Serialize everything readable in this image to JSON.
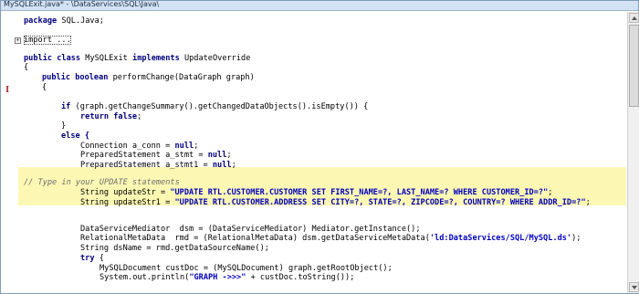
{
  "window": {
    "title": "MySQLExit.java* - \\DataServices\\SQL\\Java\\"
  },
  "colors": {
    "keyword": "#00007f",
    "string": "#0000c0",
    "comment": "#6f6f6f",
    "highlight": "#fcf8b4"
  },
  "gutter": {
    "cursor_marker": "I"
  },
  "code": {
    "l1_kw": "package",
    "l1_text": " SQL.Java;",
    "l2_text": "import ...",
    "l3_kw": "public class",
    "l3_name": " MySQLExit ",
    "l3_kw2": "implements",
    "l3_rest": " UpdateOverride",
    "l4_text": "{",
    "l5_kw": "public boolean",
    "l5_rest": " performChange(DataGraph graph)",
    "l6_text": "{",
    "l7_kw": "if",
    "l7_rest": " (graph.getChangeSummary().getChangedDataObjects().isEmpty()) {",
    "l8_kw": "return",
    "l8_kw2": " false",
    "l8_rest": ";",
    "l9_text": "}",
    "l10_text": "else {",
    "l11_text": "Connection a_conn = ",
    "l11_kw": "null",
    "l11_end": ";",
    "l12_text": "PreparedStatement a_stmt = ",
    "l12_kw": "null",
    "l12_end": ";",
    "l13_text": "PreparedStatement a_stmt1 = ",
    "l13_kw": "null",
    "l13_end": ";",
    "l14_comment": "// Type in your UPDATE statements",
    "l15_text": "String updateStr = ",
    "l15_str": "\"UPDATE RTL.CUSTOMER.CUSTOMER SET FIRST_NAME=?, LAST_NAME=? WHERE CUSTOMER_ID=?\"",
    "l15_end": ";",
    "l16_text": "String updateStr1 = ",
    "l16_str": "\"UPDATE RTL.CUSTOMER.ADDRESS SET CITY=?, STATE=?, ZIPCODE=?, COUNTRY=? WHERE ADDR_ID=?\"",
    "l16_end": ";",
    "l17_text": "DataServiceMediator  dsm = (DataServiceMediator) Mediator.getInstance();",
    "l18_text": "RelationalMetaData  rmd = (RelationalMetaData) dsm.getDataServiceMetaData(",
    "l18_str": "'ld:DataServices/SQL/MySQL.ds'",
    "l18_end": ");",
    "l19_text": "String dsName = rmd.getDataSourceName();",
    "l20_kw": "try",
    "l20_rest": " {",
    "l21_text": "MySQLDocument custDoc = (MySQLDocument) graph.getRootObject();",
    "l22_text": "System.out.println(",
    "l22_str": "\"GRAPH ->>>\"",
    "l22_end": " + custDoc.toString());"
  }
}
